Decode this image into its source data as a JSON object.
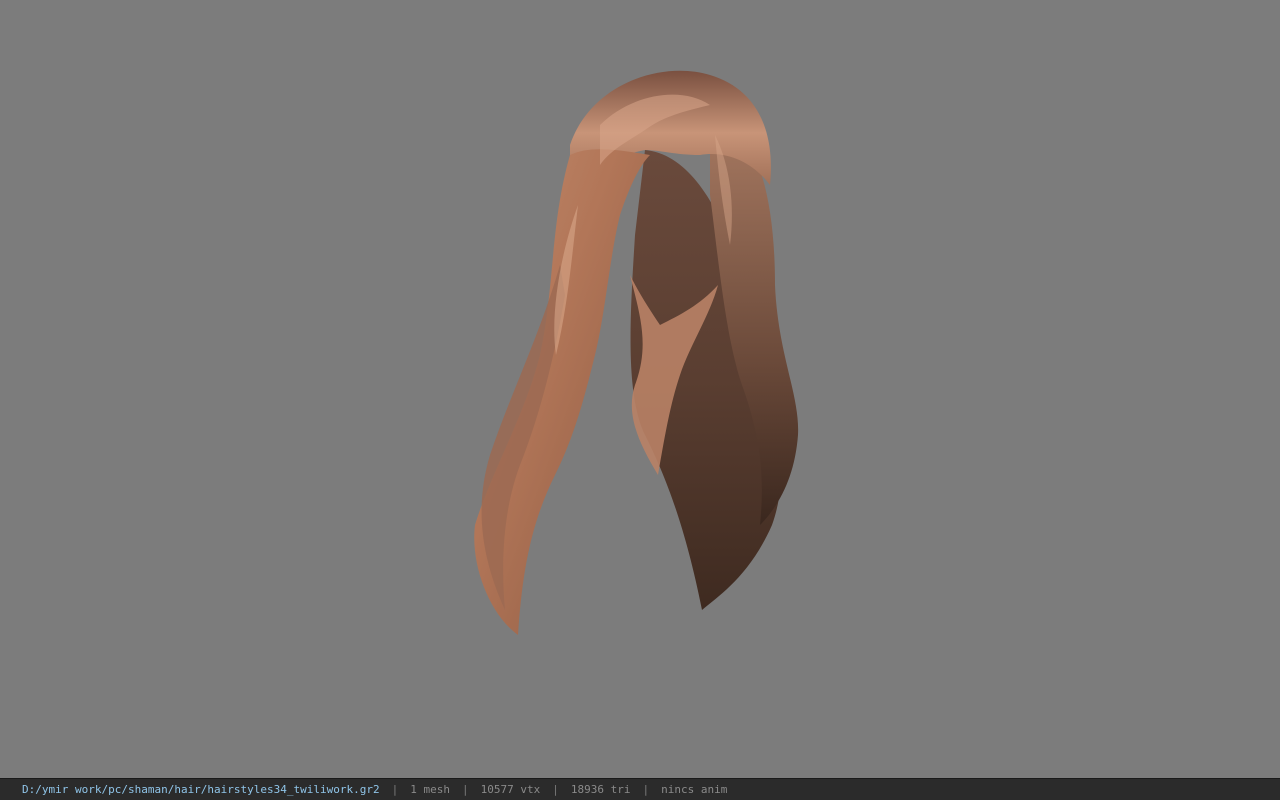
{
  "viewport": {
    "background": "#7c7c7c",
    "model_icon": "hair-mesh-render"
  },
  "status": {
    "file_path": "D:/ymir work/pc/shaman/hair/hairstyles34_twiliwork.gr2",
    "separator": "|",
    "meshes": "1 mesh",
    "vertices": "10577 vtx",
    "triangles": "18936 tri",
    "animation": "nincs anim"
  },
  "colors": {
    "statusbar_bg": "#2b2b2b",
    "path_text": "#8fc4e8",
    "info_text": "#8a8a8a"
  }
}
